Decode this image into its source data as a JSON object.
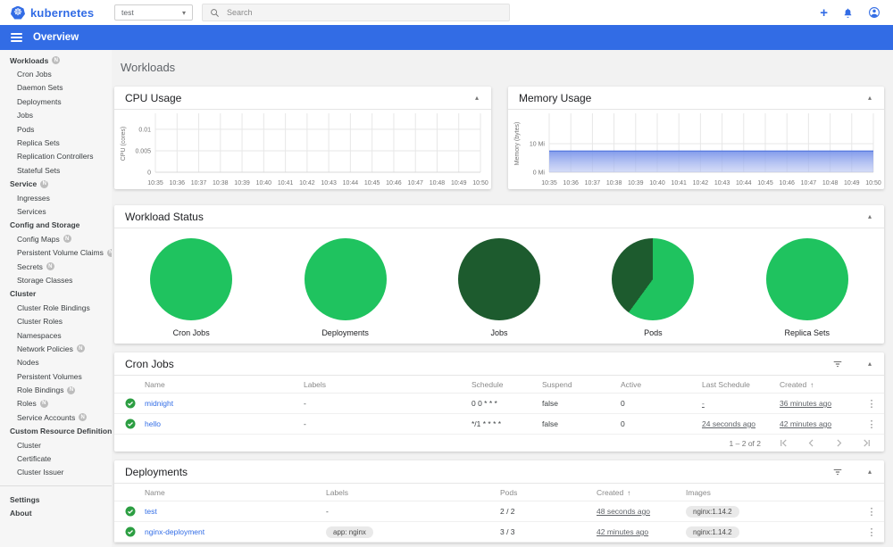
{
  "header": {
    "brand": "kubernetes",
    "namespace": {
      "value": "test"
    },
    "search": {
      "placeholder": "Search"
    }
  },
  "appbar": {
    "title": "Overview"
  },
  "page": {
    "title": "Workloads"
  },
  "icons": {
    "logo": "kubernetes-helm-wheel",
    "menu": "hamburger",
    "search": "magnifier",
    "create": "plus",
    "notifications": "bell",
    "account": "person-circle",
    "collapse": "caret-up",
    "namespace_caret": "caret-down",
    "filter": "funnel",
    "status_ok": "check-circle",
    "row_menu": "kebab",
    "sort": "arrow-up",
    "pagination": [
      "first-page",
      "chevron-left",
      "chevron-right",
      "last-page"
    ],
    "badge_char": "N",
    "plus_char": "+",
    "kebab_char": "⋮",
    "caret_up_char": "▴",
    "caret_down_char": "▾",
    "sort_char": "↑"
  },
  "colors": {
    "brand_blue": "#326ce5",
    "link_blue": "#326de6",
    "green_bright": "#1fc35f",
    "green_dark": "#1d5b2e",
    "check_green": "#2c9e42",
    "memory_fill_top": "#7b96ea",
    "memory_line": "#5b7de0"
  },
  "sidebar": {
    "items": [
      {
        "label": "Workloads",
        "type": "grp",
        "badge": true
      },
      {
        "label": "Cron Jobs",
        "type": "itm"
      },
      {
        "label": "Daemon Sets",
        "type": "itm"
      },
      {
        "label": "Deployments",
        "type": "itm"
      },
      {
        "label": "Jobs",
        "type": "itm"
      },
      {
        "label": "Pods",
        "type": "itm"
      },
      {
        "label": "Replica Sets",
        "type": "itm"
      },
      {
        "label": "Replication Controllers",
        "type": "itm"
      },
      {
        "label": "Stateful Sets",
        "type": "itm"
      },
      {
        "label": "Service",
        "type": "grp",
        "badge": true
      },
      {
        "label": "Ingresses",
        "type": "itm"
      },
      {
        "label": "Services",
        "type": "itm"
      },
      {
        "label": "Config and Storage",
        "type": "hd"
      },
      {
        "label": "Config Maps",
        "type": "itm",
        "badge": true
      },
      {
        "label": "Persistent Volume Claims",
        "type": "itm",
        "badge": true
      },
      {
        "label": "Secrets",
        "type": "itm",
        "badge": true
      },
      {
        "label": "Storage Classes",
        "type": "itm"
      },
      {
        "label": "Cluster",
        "type": "hd"
      },
      {
        "label": "Cluster Role Bindings",
        "type": "itm"
      },
      {
        "label": "Cluster Roles",
        "type": "itm"
      },
      {
        "label": "Namespaces",
        "type": "itm"
      },
      {
        "label": "Network Policies",
        "type": "itm",
        "badge": true
      },
      {
        "label": "Nodes",
        "type": "itm"
      },
      {
        "label": "Persistent Volumes",
        "type": "itm"
      },
      {
        "label": "Role Bindings",
        "type": "itm",
        "badge": true
      },
      {
        "label": "Roles",
        "type": "itm",
        "badge": true
      },
      {
        "label": "Service Accounts",
        "type": "itm",
        "badge": true
      },
      {
        "label": "Custom Resource Definitions",
        "type": "hd"
      },
      {
        "label": "Cluster",
        "type": "itm"
      },
      {
        "label": "Certificate",
        "type": "itm"
      },
      {
        "label": "Cluster Issuer",
        "type": "itm"
      },
      {
        "type": "div"
      },
      {
        "label": "Settings",
        "type": "grp"
      },
      {
        "label": "About",
        "type": "grp"
      }
    ]
  },
  "chart_data": [
    {
      "id": "cpu",
      "type": "area",
      "title": "CPU Usage",
      "ylabel": "CPU (cores)",
      "x": [
        "10:35",
        "10:36",
        "10:37",
        "10:38",
        "10:39",
        "10:40",
        "10:41",
        "10:42",
        "10:43",
        "10:44",
        "10:45",
        "10:46",
        "10:47",
        "10:48",
        "10:49",
        "10:50"
      ],
      "yticks": [
        {
          "v": 0.01,
          "label": "0.01"
        },
        {
          "v": 0.005,
          "label": "0.005"
        },
        {
          "v": 0,
          "label": "0"
        }
      ],
      "ylim": [
        0,
        0.0133
      ],
      "series": []
    },
    {
      "id": "memory",
      "type": "area",
      "title": "Memory Usage",
      "ylabel": "Memory (bytes)",
      "x": [
        "10:35",
        "10:36",
        "10:37",
        "10:38",
        "10:39",
        "10:40",
        "10:41",
        "10:42",
        "10:43",
        "10:44",
        "10:45",
        "10:46",
        "10:47",
        "10:48",
        "10:49",
        "10:50"
      ],
      "yticks": [
        {
          "v": 10,
          "label": "10 Mi"
        },
        {
          "v": 0,
          "label": "0 Mi"
        }
      ],
      "ylim": [
        0,
        20
      ],
      "series": [
        {
          "name": "memory-usage-mi",
          "values": [
            7.4,
            7.4,
            7.4,
            7.4,
            7.4,
            7.4,
            7.4,
            7.4,
            7.4,
            7.4,
            7.4,
            7.4,
            7.4,
            7.4,
            7.4,
            7.4
          ]
        }
      ]
    },
    {
      "id": "workload-status",
      "type": "pie-set",
      "title": "Workload Status",
      "pies": [
        {
          "label": "Cron Jobs",
          "segments": [
            {
              "name": "running",
              "fraction": 1,
              "color": "#1fc35f"
            }
          ]
        },
        {
          "label": "Deployments",
          "segments": [
            {
              "name": "running",
              "fraction": 1,
              "color": "#1fc35f"
            }
          ]
        },
        {
          "label": "Jobs",
          "segments": [
            {
              "name": "succeeded",
              "fraction": 1,
              "color": "#1d5b2e"
            }
          ]
        },
        {
          "label": "Pods",
          "segments": [
            {
              "name": "running",
              "fraction": 0.6,
              "color": "#1fc35f"
            },
            {
              "name": "succeeded",
              "fraction": 0.4,
              "color": "#1d5b2e"
            }
          ]
        },
        {
          "label": "Replica Sets",
          "segments": [
            {
              "name": "running",
              "fraction": 1,
              "color": "#1fc35f"
            }
          ]
        }
      ]
    }
  ],
  "tables": {
    "cron": {
      "title": "Cron Jobs",
      "columns": [
        "Name",
        "Labels",
        "Schedule",
        "Suspend",
        "Active",
        "Last Schedule",
        "Created"
      ],
      "sorted_by": "Created",
      "rows": [
        {
          "name": "midnight",
          "labels": "-",
          "schedule": "0 0 * * *",
          "suspend": "false",
          "active": "0",
          "last_schedule": "-",
          "created": "36 minutes ago"
        },
        {
          "name": "hello",
          "labels": "-",
          "schedule": "*/1 * * * *",
          "suspend": "false",
          "active": "0",
          "last_schedule": "24 seconds ago",
          "created": "42 minutes ago"
        }
      ],
      "pagination": {
        "label": "1 – 2 of 2"
      }
    },
    "deployments": {
      "title": "Deployments",
      "columns": [
        "Name",
        "Labels",
        "Pods",
        "Created",
        "Images"
      ],
      "sorted_by": "Created",
      "rows": [
        {
          "name": "test",
          "labels": "-",
          "pods": "2 / 2",
          "created": "48 seconds ago",
          "images": "nginx:1.14.2"
        },
        {
          "name": "nginx-deployment",
          "labels": "app: nginx",
          "pods": "3 / 3",
          "created": "42 minutes ago",
          "images": "nginx:1.14.2"
        }
      ]
    }
  }
}
